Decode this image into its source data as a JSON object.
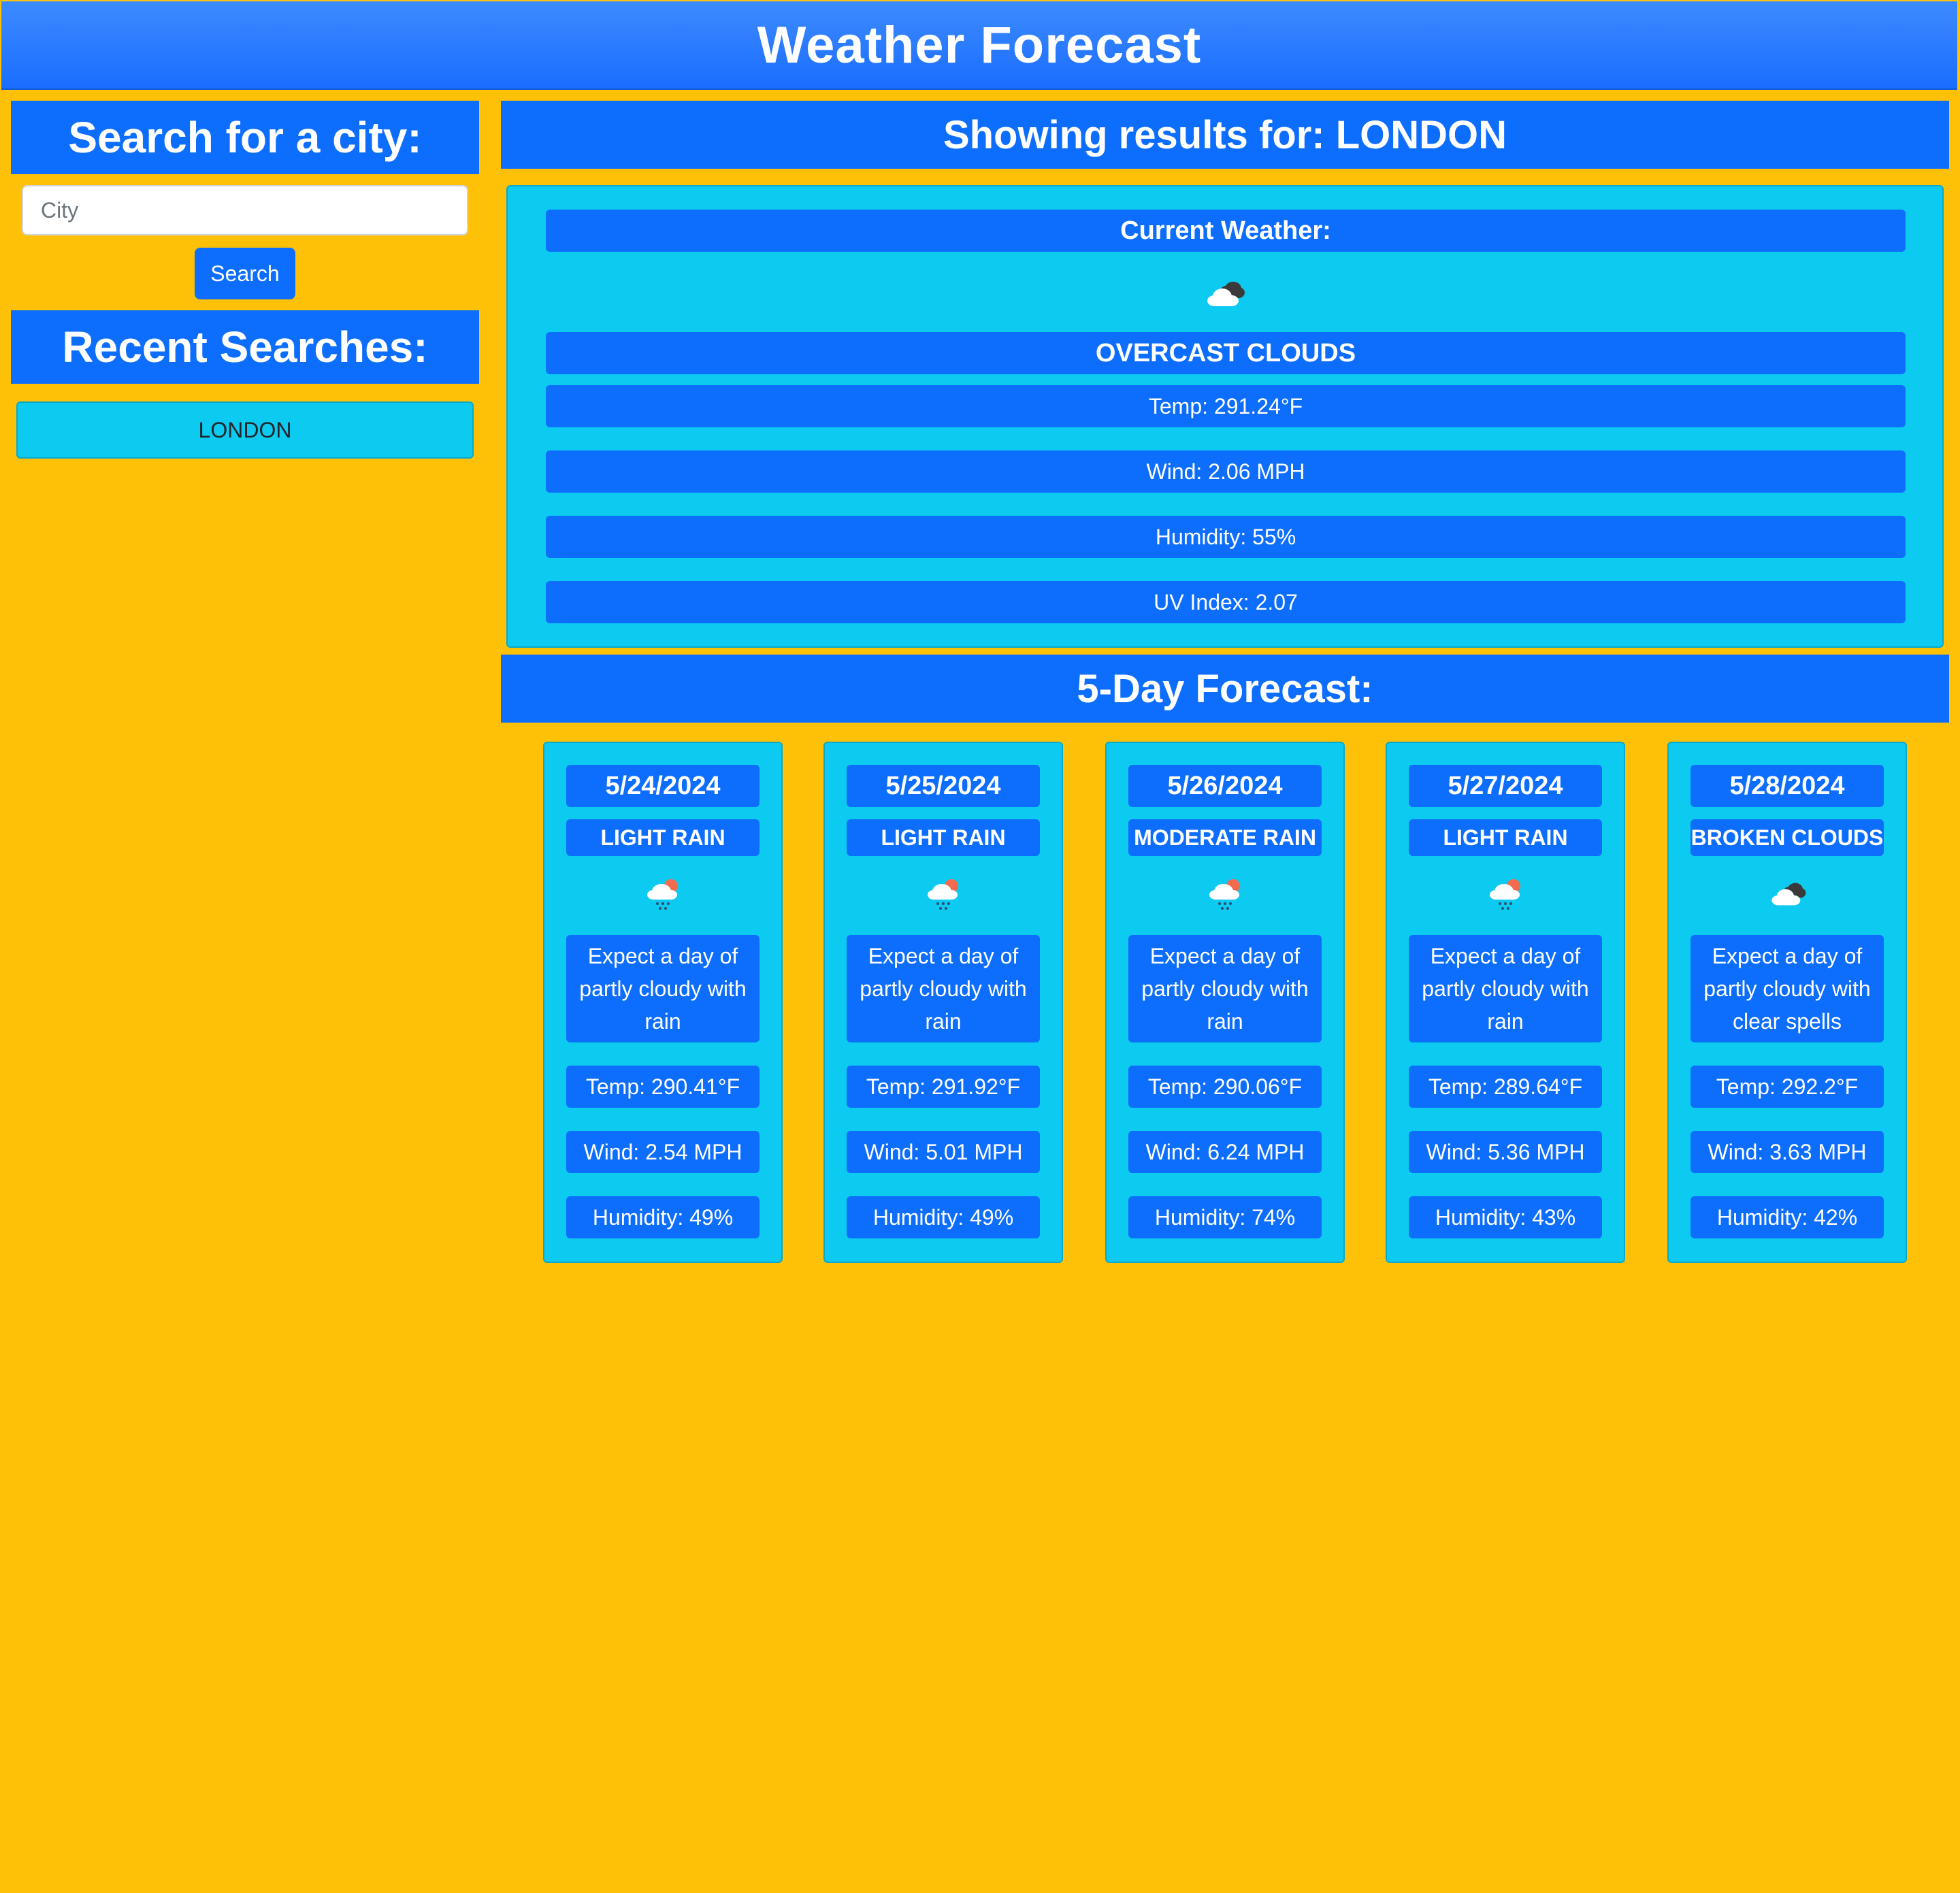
{
  "header": {
    "title": "Weather Forecast"
  },
  "sidebar": {
    "search_title": "Search for a city:",
    "search_input": {
      "placeholder": "City",
      "value": ""
    },
    "search_button": "Search",
    "recent_title": "Recent Searches:",
    "recent_items": [
      "LONDON"
    ]
  },
  "results": {
    "title": "Showing results for: LONDON"
  },
  "current": {
    "title": "Current Weather:",
    "icon": "overcast-clouds-icon",
    "description": "OVERCAST CLOUDS",
    "temp": "Temp: 291.24°F",
    "wind": "Wind: 2.06 MPH",
    "humidity": "Humidity: 55%",
    "uv": "UV Index: 2.07"
  },
  "forecast": {
    "title": "5-Day Forecast:",
    "days": [
      {
        "date": "5/24/2024",
        "description": "LIGHT RAIN",
        "icon": "rain-icon",
        "text": "Expect a day of partly cloudy with rain",
        "temp": "Temp: 290.41°F",
        "wind": "Wind: 2.54 MPH",
        "humidity": "Humidity: 49%"
      },
      {
        "date": "5/25/2024",
        "description": "LIGHT RAIN",
        "icon": "rain-icon",
        "text": "Expect a day of partly cloudy with rain",
        "temp": "Temp: 291.92°F",
        "wind": "Wind: 5.01 MPH",
        "humidity": "Humidity: 49%"
      },
      {
        "date": "5/26/2024",
        "description": "MODERATE RAIN",
        "icon": "rain-icon",
        "text": "Expect a day of partly cloudy with rain",
        "temp": "Temp: 290.06°F",
        "wind": "Wind: 6.24 MPH",
        "humidity": "Humidity: 74%"
      },
      {
        "date": "5/27/2024",
        "description": "LIGHT RAIN",
        "icon": "rain-icon",
        "text": "Expect a day of partly cloudy with rain",
        "temp": "Temp: 289.64°F",
        "wind": "Wind: 5.36 MPH",
        "humidity": "Humidity: 43%"
      },
      {
        "date": "5/28/2024",
        "description": "BROKEN CLOUDS",
        "icon": "broken-clouds-icon",
        "text": "Expect a day of partly cloudy with clear spells",
        "temp": "Temp: 292.2°F",
        "wind": "Wind: 3.63 MPH",
        "humidity": "Humidity: 42%"
      }
    ]
  },
  "colors": {
    "background": "#ffc107",
    "primary": "#0d6efd",
    "info": "#0dcaf0",
    "header_gradient_top": "#3d8bff"
  }
}
